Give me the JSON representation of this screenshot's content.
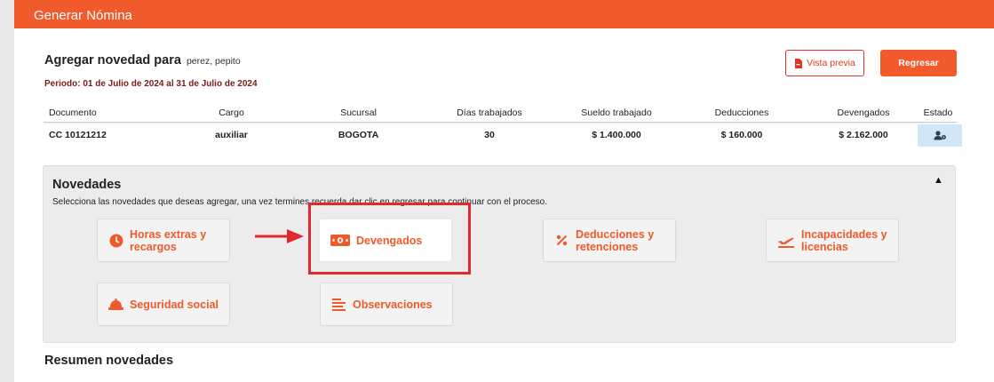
{
  "header": {
    "title": "Generar Nómina"
  },
  "page": {
    "title": "Agregar novedad para",
    "client": "perez, pepito",
    "period": "Periodo: 01 de Julio de 2024 al 31 de Julio de 2024"
  },
  "actions": {
    "preview_label": "Vista previa",
    "back_label": "Regresar"
  },
  "table": {
    "headers": [
      "Documento",
      "Cargo",
      "Sucursal",
      "Días trabajados",
      "Sueldo trabajado",
      "Deducciones",
      "Devengados",
      "Estado"
    ],
    "row": [
      "CC 10121212",
      "auxiliar",
      "BOGOTA",
      "30",
      "$ 1.400.000",
      "$ 160.000",
      "$ 2.162.000"
    ]
  },
  "novedades": {
    "title": "Novedades",
    "description": "Selecciona las novedades que deseas agregar, una vez termines recuerda dar clic en regresar para continuar con el proceso.",
    "toggle": "▲",
    "cards": [
      {
        "label_line1": "Horas extras y",
        "label_line2": "recargos",
        "icon": "clock-icon"
      },
      {
        "label_line1": "Devengados",
        "label_line2": "",
        "icon": "money-icon"
      },
      {
        "label_line1": "Deducciones y",
        "label_line2": "retenciones",
        "icon": "percent-icon"
      },
      {
        "label_line1": "Incapacidades y",
        "label_line2": "licencias",
        "icon": "plane-icon"
      },
      {
        "label_line1": "Seguridad social",
        "label_line2": "",
        "icon": "helmet-icon"
      },
      {
        "label_line1": "Observaciones",
        "label_line2": "",
        "icon": "list-icon"
      }
    ]
  },
  "summary": {
    "title": "Resumen novedades"
  },
  "colors": {
    "accent": "#f15a2b",
    "highlight": "#e0282e",
    "status_bg": "#cfe7f7"
  }
}
